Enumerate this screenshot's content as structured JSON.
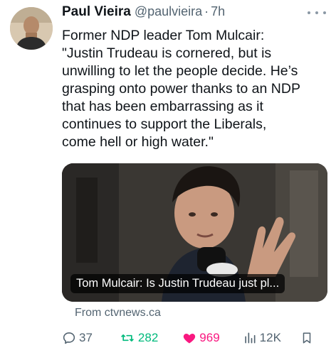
{
  "tweet": {
    "author_name": "Paul Vieira",
    "handle": "@paulvieira",
    "separator": "·",
    "time": "7h",
    "text_lines": [
      "Former NDP leader Tom Mulcair:",
      "\"Justin Trudeau is cornered, but is",
      "unwilling to let the people decide. He’s",
      "grasping onto power thanks to an NDP",
      "that has been embarrassing as it",
      "continues to support the Liberals,",
      "come hell or high water.\""
    ]
  },
  "card": {
    "caption": "Tom Mulcair: Is Justin Trudeau just pl...",
    "source": "From ctvnews.ca"
  },
  "actions": {
    "replies": "37",
    "retweets": "282",
    "likes": "969",
    "views": "12K"
  },
  "colors": {
    "text": "#0f1419",
    "secondary": "#536471",
    "retweet_active": "#00ba7c",
    "like_active": "#f91880"
  },
  "icons": {
    "more": "more-horizontal-icon",
    "reply": "reply-icon",
    "retweet": "retweet-icon",
    "like": "heart-filled-icon",
    "views": "views-bars-icon",
    "bookmark": "bookmark-icon",
    "share": "share-icon"
  }
}
